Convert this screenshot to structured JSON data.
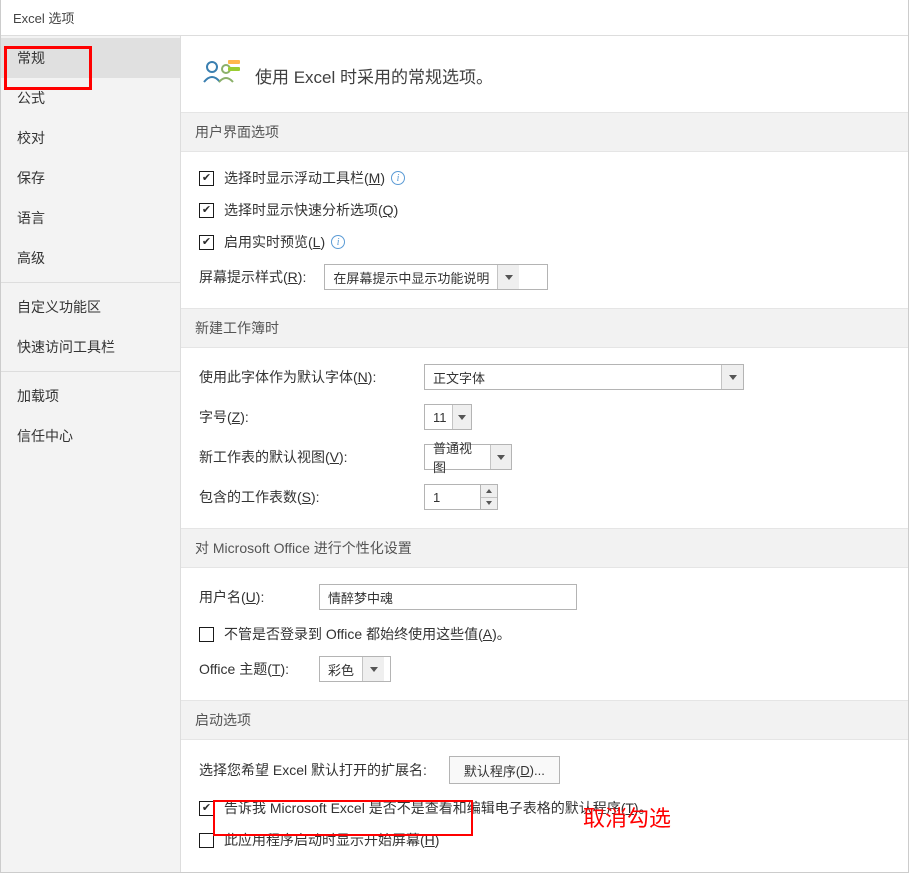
{
  "title": "Excel 选项",
  "sidebar": {
    "items": [
      {
        "label": "常规",
        "selected": true
      },
      {
        "label": "公式"
      },
      {
        "label": "校对"
      },
      {
        "label": "保存"
      },
      {
        "label": "语言"
      },
      {
        "label": "高级"
      },
      {
        "divider": true
      },
      {
        "label": "自定义功能区"
      },
      {
        "label": "快速访问工具栏"
      },
      {
        "divider": true
      },
      {
        "label": "加载项"
      },
      {
        "label": "信任中心"
      }
    ]
  },
  "main": {
    "header_text": "使用 Excel 时采用的常规选项。",
    "sections": {
      "ui": {
        "heading": "用户界面选项",
        "opt_minibar_pre": "选择时显示浮动工具栏(",
        "opt_minibar_key": "M",
        "opt_minibar_post": ")",
        "opt_quick_pre": "选择时显示快速分析选项(",
        "opt_quick_key": "Q",
        "opt_quick_post": ")",
        "opt_live_pre": "启用实时预览(",
        "opt_live_key": "L",
        "opt_live_post": ")",
        "screentip_label_pre": "屏幕提示样式(",
        "screentip_label_key": "R",
        "screentip_label_post": "):",
        "screentip_value": "在屏幕提示中显示功能说明"
      },
      "newwb": {
        "heading": "新建工作簿时",
        "font_label_pre": "使用此字体作为默认字体(",
        "font_label_key": "N",
        "font_label_post": "):",
        "font_value": "正文字体",
        "size_label_pre": "字号(",
        "size_label_key": "Z",
        "size_label_post": "):",
        "size_value": "11",
        "view_label_pre": "新工作表的默认视图(",
        "view_label_key": "V",
        "view_label_post": "):",
        "view_value": "普通视图",
        "sheets_label_pre": "包含的工作表数(",
        "sheets_label_key": "S",
        "sheets_label_post": "):",
        "sheets_value": "1"
      },
      "personal": {
        "heading": "对 Microsoft Office 进行个性化设置",
        "user_label_pre": "用户名(",
        "user_label_key": "U",
        "user_label_post": "):",
        "user_value": "情醉梦中魂",
        "always_pre": "不管是否登录到 Office 都始终使用这些值(",
        "always_key": "A",
        "always_post": ")。",
        "theme_label_pre": "Office 主题(",
        "theme_label_key": "T",
        "theme_label_post": "):",
        "theme_value": "彩色"
      },
      "startup": {
        "heading": "启动选项",
        "ext_label": "选择您希望 Excel 默认打开的扩展名:",
        "ext_btn_pre": "默认程序(",
        "ext_btn_key": "D",
        "ext_btn_post": ")...",
        "tellme_pre": "告诉我 Microsoft Excel 是否不是查看和编辑电子表格的默认程序(",
        "tellme_key": "T",
        "tellme_post": ")。",
        "startscreen_pre": "此应用程序启动时显示开始屏幕(",
        "startscreen_key": "H",
        "startscreen_post": ")"
      }
    }
  },
  "annotation": {
    "uncheck_label": "取消勾选"
  }
}
